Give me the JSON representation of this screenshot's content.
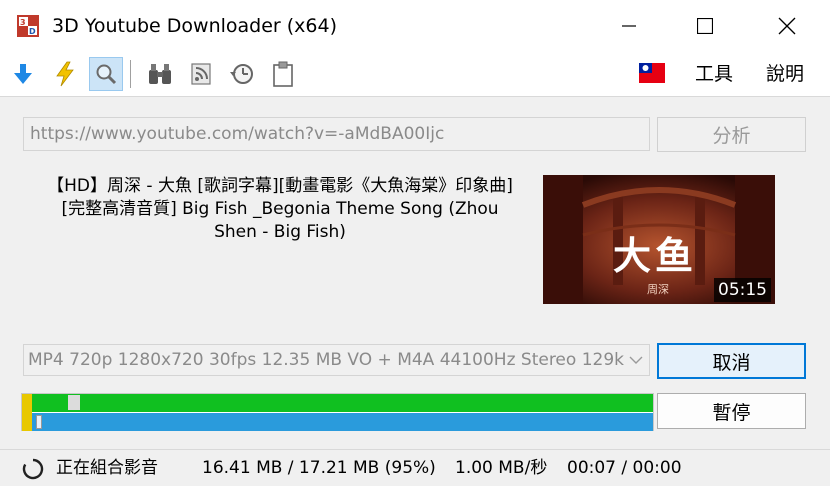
{
  "window": {
    "title": "3D Youtube Downloader (x64)",
    "controls": [
      "minimize",
      "maximize",
      "close"
    ]
  },
  "toolbar": {
    "icons": [
      "download-arrow-icon",
      "lightning-icon",
      "magnifier-icon",
      "binoculars-icon",
      "rss-icon",
      "clock-icon",
      "clipboard-icon"
    ],
    "flag": "taiwan-flag-icon",
    "menu_tools": "工具",
    "menu_help": "說明"
  },
  "url": {
    "value": "https://www.youtube.com/watch?v=-aMdBA00Ijc"
  },
  "analyze_label": "分析",
  "video": {
    "title": "【HD】周深 - 大魚 [歌詞字幕][動畫電影《大魚海棠》印象曲][完整高清音質] Big Fish _Begonia Theme Song (Zhou Shen - Big Fish)",
    "thumbnail_title": "大鱼",
    "thumbnail_artist": "周深",
    "duration": "05:15"
  },
  "format": {
    "selected": "MP4 720p 1280x720 30fps 12.35 MB VO + M4A 44100Hz Stereo 129k"
  },
  "cancel_label": "取消",
  "pause_label": "暫停",
  "progress": {
    "video_fraction": 1.0,
    "audio_fraction": 1.0,
    "colors": {
      "video": "#10c020",
      "audio": "#2a9bdc",
      "merge": "#e8c800"
    }
  },
  "status": {
    "state": "正在組合影音",
    "size": "16.41 MB / 17.21 MB (95%)",
    "speed": "1.00 MB/秒",
    "time": "00:07 / 00:00"
  }
}
